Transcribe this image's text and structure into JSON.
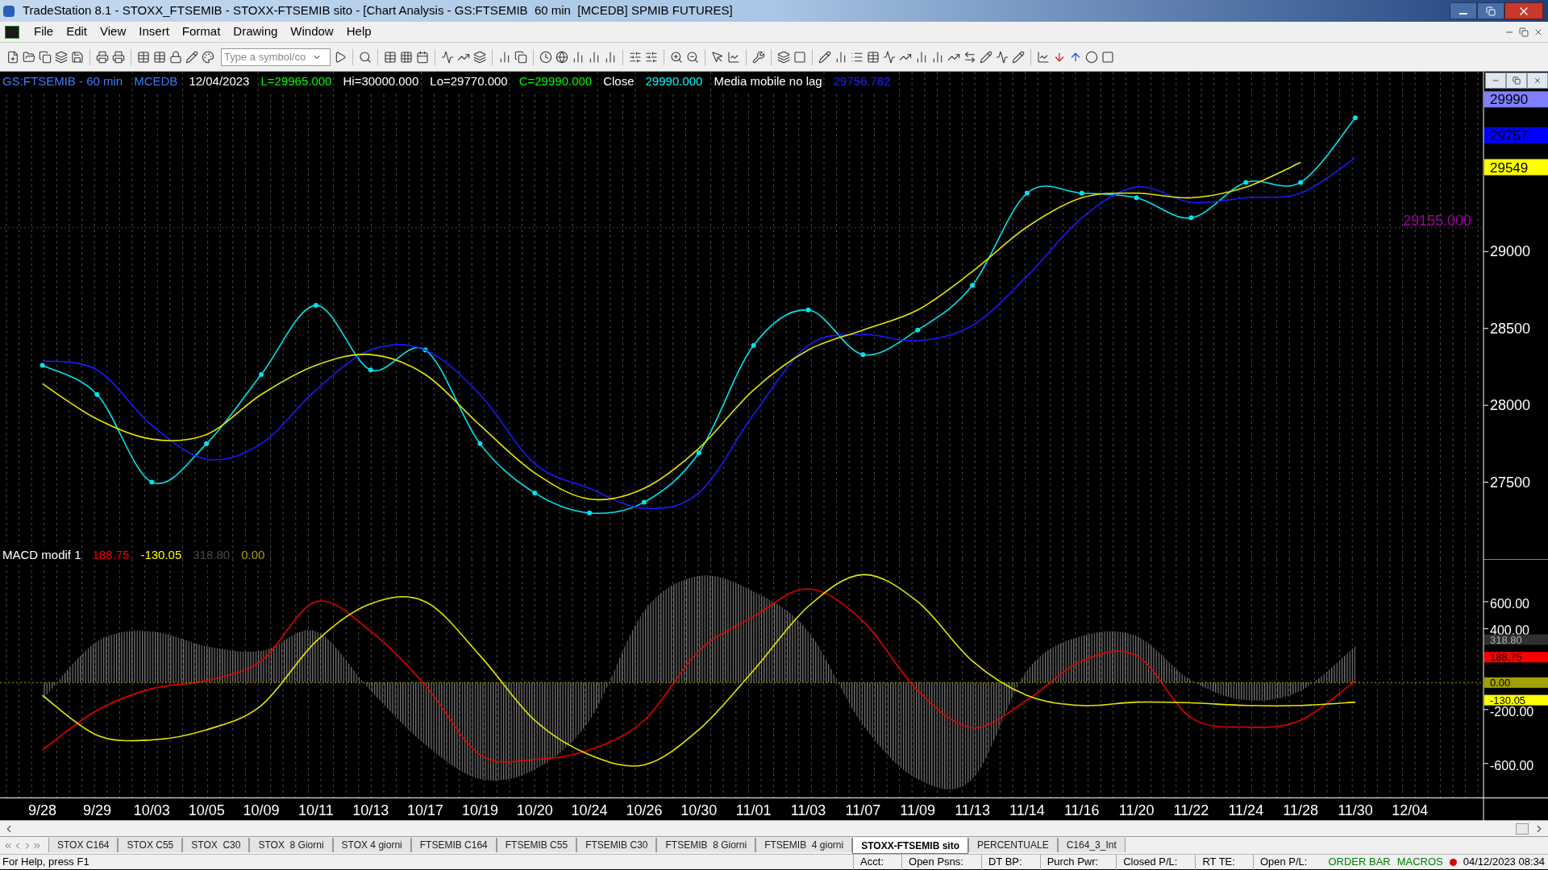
{
  "window": {
    "title": "TradeStation 8.1 - STOXX_FTSEMIB - STOXX-FTSEMIB sito - [Chart Analysis - GS:FTSEMIB  60 min  [MCEDB] SPMIB FUTURES]"
  },
  "menu": [
    "File",
    "Edit",
    "View",
    "Insert",
    "Format",
    "Drawing",
    "Window",
    "Help"
  ],
  "toolbar": {
    "symbol_field": {
      "placeholder": "Type a symbol/co"
    }
  },
  "price_panel": {
    "legend": [
      {
        "text": "GS:FTSEMIB - 60 min",
        "color": "#3d7bff"
      },
      {
        "text": "MCEDB",
        "color": "#3d7bff"
      },
      {
        "text": "12/04/2023",
        "color": "#ffffff"
      },
      {
        "text": "L=29965.000",
        "color": "#00ff00"
      },
      {
        "text": "Hi=30000.000",
        "color": "#ffffff"
      },
      {
        "text": "Lo=29770.000",
        "color": "#ffffff"
      },
      {
        "text": "C=29990.000",
        "color": "#00ff00"
      },
      {
        "text": "Close",
        "color": "#ffffff"
      },
      {
        "text": "29990.000",
        "color": "#00ffff"
      },
      {
        "text": "Media mobile no lag",
        "color": "#ffffff"
      },
      {
        "text": "29756.782",
        "color": "#2020ff"
      }
    ],
    "badges": [
      {
        "text": "29990",
        "color": "#8080ff"
      },
      {
        "text": "29757",
        "color": "#0000ff"
      },
      {
        "text": "29549",
        "color": "#ffff00"
      }
    ],
    "chart_data": {
      "type": "line",
      "grid": true,
      "ylim": [
        27000,
        30170
      ],
      "yticks": [
        27500,
        28000,
        28500,
        29000
      ],
      "ref_lines": [
        {
          "axis": "y",
          "value": 29155,
          "label": "29155.000",
          "color": "#a000a0"
        }
      ],
      "series": [
        {
          "color": "#00e5ee",
          "marker": true,
          "values": [
            28260,
            28070,
            27500,
            27750,
            28200,
            28650,
            28230,
            28360,
            27750,
            27430,
            27300,
            27370,
            27690,
            28390,
            28620,
            28330,
            28490,
            28780,
            29380,
            29380,
            29350,
            29220,
            29450,
            29450,
            29870,
            null
          ]
        },
        {
          "color": "#1a1aff",
          "values": [
            28290,
            28230,
            27870,
            27650,
            27750,
            28100,
            28360,
            28360,
            28070,
            27620,
            27460,
            27330,
            27430,
            27940,
            28390,
            28460,
            28420,
            28520,
            28840,
            29220,
            29420,
            29320,
            29350,
            29380,
            29610,
            null
          ]
        },
        {
          "color": "#e6e600",
          "values": [
            28140,
            27910,
            27780,
            27810,
            28070,
            28260,
            28330,
            28200,
            27870,
            27560,
            27390,
            27460,
            27720,
            28100,
            28360,
            28490,
            28620,
            28870,
            29160,
            29350,
            29380,
            29350,
            29420,
            29580,
            null,
            null
          ]
        }
      ]
    }
  },
  "macd_panel": {
    "legend": [
      {
        "text": "MACD modif 1",
        "color": "#ffffff"
      },
      {
        "text": "188.75",
        "color": "#ff0000"
      },
      {
        "text": "-130.05",
        "color": "#ffff00"
      },
      {
        "text": "318.80",
        "color": "#4a4a4a"
      },
      {
        "text": "0.00",
        "color": "#a0a000"
      }
    ],
    "badges": [
      {
        "text": "318.80",
        "color": "#303030"
      },
      {
        "text": "188.75",
        "color": "#ff0000"
      },
      {
        "text": "0.00",
        "color": "#a0a000"
      },
      {
        "text": "-130.05",
        "color": "#ffff00"
      }
    ],
    "chart_data": {
      "type": "line",
      "grid": true,
      "categories": [
        "9/28",
        "9/29",
        "10/03",
        "10/05",
        "10/09",
        "10/11",
        "10/13",
        "10/17",
        "10/19",
        "10/20",
        "10/24",
        "10/26",
        "10/30",
        "11/01",
        "11/03",
        "11/07",
        "11/09",
        "11/13",
        "11/14",
        "11/16",
        "11/20",
        "11/22",
        "11/24",
        "11/28",
        "11/30",
        "12/04"
      ],
      "ylim": [
        -852,
        916
      ],
      "yticks": [
        {
          "value": 600,
          "label": "600.00"
        },
        {
          "value": 400,
          "label": "400.00"
        },
        {
          "value": -200,
          "label": "-200.00"
        },
        {
          "value": -600,
          "label": "-600.00"
        }
      ],
      "ref_lines": [
        {
          "axis": "y",
          "value": 0,
          "color": "#a0a000"
        }
      ],
      "series": [
        {
          "type": "area",
          "color": "#7a7a7a",
          "values": [
            -130,
            305,
            380,
            270,
            235,
            380,
            -60,
            -460,
            -715,
            -645,
            -280,
            530,
            790,
            675,
            380,
            -315,
            -715,
            -715,
            90,
            345,
            345,
            15,
            -130,
            -60,
            270,
            null
          ]
        },
        {
          "color": "#e00000",
          "values": [
            -500,
            -205,
            -45,
            15,
            160,
            600,
            380,
            -20,
            -535,
            -570,
            -500,
            -280,
            235,
            490,
            695,
            455,
            -60,
            -335,
            -130,
            160,
            200,
            -260,
            -330,
            -280,
            15,
            null
          ]
        },
        {
          "color": "#e6e600",
          "values": [
            -95,
            -390,
            -425,
            -350,
            -170,
            305,
            585,
            600,
            200,
            -280,
            -535,
            -610,
            -350,
            90,
            565,
            800,
            600,
            160,
            -95,
            -170,
            -145,
            -150,
            -170,
            -170,
            -145,
            null
          ]
        }
      ]
    }
  },
  "tabs": [
    {
      "label": "STOX C164",
      "selected": false
    },
    {
      "label": "STOX C55",
      "selected": false
    },
    {
      "label": "STOX  C30",
      "selected": false
    },
    {
      "label": "STOX  8 Giorni",
      "selected": false
    },
    {
      "label": "STOX 4 giorni",
      "selected": false
    },
    {
      "label": "FTSEMIB C164",
      "selected": false
    },
    {
      "label": "FTSEMIB C55",
      "selected": false
    },
    {
      "label": "FTSEMIB C30",
      "selected": false
    },
    {
      "label": "FTSEMIB  8 Giorni",
      "selected": false
    },
    {
      "label": "FTSEMIB  4 giorni",
      "selected": false
    },
    {
      "label": "STOXX-FTSEMIB sito",
      "selected": true
    },
    {
      "label": "PERCENTUALE",
      "selected": false
    },
    {
      "label": "C164_3_Int",
      "selected": false
    }
  ],
  "status_bar": {
    "help": "For Help, press F1",
    "fields": [
      "Acct:",
      "Open Psns:",
      "DT BP:",
      "Purch Pwr:",
      "Closed P/L:",
      "RT TE:",
      "Open P/L:"
    ],
    "indicators": [
      {
        "text": "ORDER BAR",
        "color": "#008000"
      },
      {
        "text": "MACROS",
        "color": "#008000"
      }
    ],
    "datetime": "04/12/2023 08:34"
  }
}
